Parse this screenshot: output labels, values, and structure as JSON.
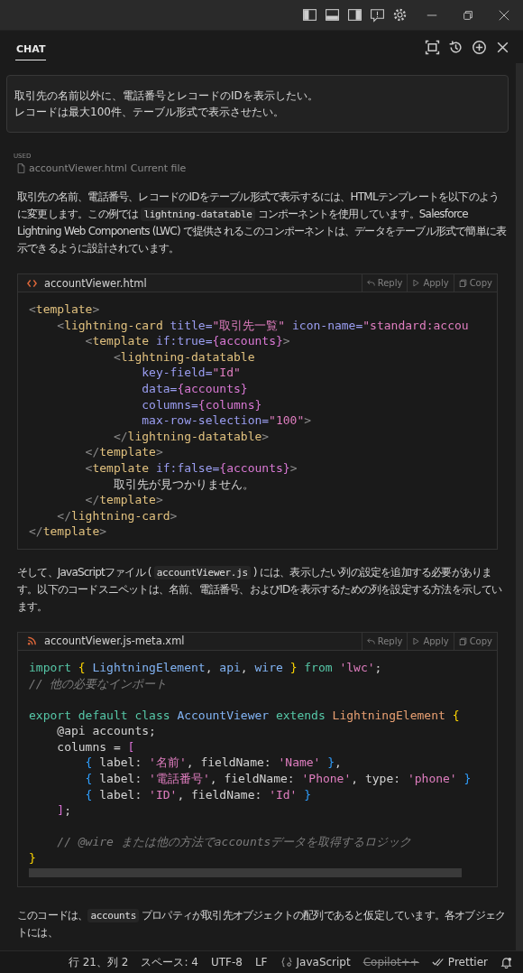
{
  "chat_tab": {
    "label": "CHAT",
    "selected": true
  },
  "user_message": [
    "取引先の名前以外に、電話番号とレコードのIDを表示したい。",
    "レコードは最大100件、テーブル形式で表示させたい。"
  ],
  "used": {
    "label": "USED",
    "file": "accountViewer.html",
    "note": "Current file"
  },
  "blocks": [
    {
      "kind": "paragraph",
      "segments": [
        {
          "kind": "text",
          "text": "取引先の名前、電話番号、レコードのIDをテーブル形式で表示するには、HTMLテンプレートを以下のように変更します。この例では "
        },
        {
          "kind": "code",
          "text": "lightning-datatable"
        },
        {
          "kind": "text",
          "text": " コンポーネントを使用しています。Salesforce Lightning Web Components (LWC) で提供されるこのコンポーネントは、データをテーブル形式で簡単に表示できるように設計されています。"
        }
      ]
    },
    {
      "kind": "code",
      "filename": "accountViewer.html",
      "actions": [
        "Reply",
        "Apply",
        "Copy"
      ],
      "scrollbar": false,
      "lines": [
        {
          "gap": false,
          "tokens": [
            {
              "kind": "punct",
              "text": "<"
            },
            {
              "kind": "tag",
              "text": "template"
            },
            {
              "kind": "punct",
              "text": ">"
            }
          ]
        },
        {
          "gap": false,
          "tokens": [
            {
              "kind": "punct",
              "text": "    <"
            },
            {
              "kind": "tag",
              "text": "lightning-card"
            },
            {
              "kind": "attr",
              "text": " title="
            },
            {
              "kind": "str",
              "text": "\"取引先一覧\""
            },
            {
              "kind": "attr",
              "text": " icon-name="
            },
            {
              "kind": "str",
              "text": "\"standard:accou"
            }
          ]
        },
        {
          "gap": false,
          "tokens": [
            {
              "kind": "punct",
              "text": "        <"
            },
            {
              "kind": "tag",
              "text": "template"
            },
            {
              "kind": "attr",
              "text": " if:true="
            },
            {
              "kind": "brace",
              "text": "{accounts}"
            },
            {
              "kind": "punct",
              "text": ">"
            }
          ]
        },
        {
          "gap": false,
          "tokens": [
            {
              "kind": "punct",
              "text": "            <"
            },
            {
              "kind": "tag",
              "text": "lightning-datatable"
            }
          ]
        },
        {
          "gap": false,
          "tokens": [
            {
              "kind": "attr",
              "text": "                key-field="
            },
            {
              "kind": "str",
              "text": "\"Id\""
            }
          ]
        },
        {
          "gap": false,
          "tokens": [
            {
              "kind": "attr",
              "text": "                data="
            },
            {
              "kind": "brace",
              "text": "{accounts}"
            }
          ]
        },
        {
          "gap": false,
          "tokens": [
            {
              "kind": "attr",
              "text": "                columns="
            },
            {
              "kind": "brace",
              "text": "{columns}"
            }
          ]
        },
        {
          "gap": false,
          "tokens": [
            {
              "kind": "attr",
              "text": "                max-row-selection="
            },
            {
              "kind": "str",
              "text": "\"100\""
            },
            {
              "kind": "punct",
              "text": ">"
            }
          ]
        },
        {
          "gap": false,
          "tokens": [
            {
              "kind": "punct",
              "text": "            </"
            },
            {
              "kind": "tag",
              "text": "lightning-datatable"
            },
            {
              "kind": "punct",
              "text": ">"
            }
          ]
        },
        {
          "gap": false,
          "tokens": [
            {
              "kind": "punct",
              "text": "        </"
            },
            {
              "kind": "tag",
              "text": "template"
            },
            {
              "kind": "punct",
              "text": ">"
            }
          ]
        },
        {
          "gap": false,
          "tokens": [
            {
              "kind": "punct",
              "text": "        <"
            },
            {
              "kind": "tag",
              "text": "template"
            },
            {
              "kind": "attr",
              "text": " if:false="
            },
            {
              "kind": "brace",
              "text": "{accounts}"
            },
            {
              "kind": "punct",
              "text": ">"
            }
          ]
        },
        {
          "gap": false,
          "tokens": [
            {
              "kind": "text",
              "text": "            取引先が見つかりません。"
            }
          ]
        },
        {
          "gap": false,
          "tokens": [
            {
              "kind": "punct",
              "text": "        </"
            },
            {
              "kind": "tag",
              "text": "template"
            },
            {
              "kind": "punct",
              "text": ">"
            }
          ]
        },
        {
          "gap": false,
          "tokens": [
            {
              "kind": "punct",
              "text": "    </"
            },
            {
              "kind": "tag",
              "text": "lightning-card"
            },
            {
              "kind": "punct",
              "text": ">"
            }
          ]
        },
        {
          "gap": false,
          "tokens": [
            {
              "kind": "punct",
              "text": "</"
            },
            {
              "kind": "tag",
              "text": "template"
            },
            {
              "kind": "punct",
              "text": ">"
            }
          ]
        }
      ]
    },
    {
      "kind": "paragraph",
      "segments": [
        {
          "kind": "text",
          "text": "そして、JavaScriptファイル ( "
        },
        {
          "kind": "code",
          "text": "accountViewer.js"
        },
        {
          "kind": "text",
          "text": " ) には、表示したい列の設定を追加する必要があります。以下のコードスニペットは、名前、電話番号、およびIDを表示するための列を設定する方法を示しています。"
        }
      ]
    },
    {
      "kind": "code",
      "filename": "accountViewer.js-meta.xml",
      "actions": [
        "Reply",
        "Apply",
        "Copy"
      ],
      "scrollbar": true,
      "lines": [
        {
          "gap": false,
          "tokens": [
            {
              "kind": "kw",
              "text": "import "
            },
            {
              "kind": "b1",
              "text": "{ "
            },
            {
              "kind": "var",
              "text": "LightningElement"
            },
            {
              "kind": "text",
              "text": ", "
            },
            {
              "kind": "var",
              "text": "api"
            },
            {
              "kind": "text",
              "text": ", "
            },
            {
              "kind": "var",
              "text": "wire "
            },
            {
              "kind": "b1",
              "text": "} "
            },
            {
              "kind": "kw",
              "text": "from "
            },
            {
              "kind": "str",
              "text": "'lwc'"
            },
            {
              "kind": "text",
              "text": ";"
            }
          ]
        },
        {
          "gap": false,
          "tokens": [
            {
              "kind": "comment",
              "text": "// 他の必要なインポート"
            }
          ]
        },
        {
          "gap": true,
          "tokens": [
            {
              "kind": "kw",
              "text": "export default class "
            },
            {
              "kind": "var",
              "text": "AccountViewer "
            },
            {
              "kind": "kw",
              "text": "extends "
            },
            {
              "kind": "cls",
              "text": "LightningElement "
            },
            {
              "kind": "b1",
              "text": "{"
            }
          ]
        },
        {
          "gap": false,
          "tokens": [
            {
              "kind": "text",
              "text": "    @api accounts;"
            }
          ]
        },
        {
          "gap": false,
          "tokens": [
            {
              "kind": "text",
              "text": "    columns = "
            },
            {
              "kind": "b2",
              "text": "["
            }
          ]
        },
        {
          "gap": false,
          "tokens": [
            {
              "kind": "b3",
              "text": "        {"
            },
            {
              "kind": "text",
              "text": " label: "
            },
            {
              "kind": "str",
              "text": "'名前'"
            },
            {
              "kind": "text",
              "text": ", fieldName: "
            },
            {
              "kind": "str",
              "text": "'Name'"
            },
            {
              "kind": "b3",
              "text": " }"
            },
            {
              "kind": "text",
              "text": ","
            }
          ]
        },
        {
          "gap": false,
          "tokens": [
            {
              "kind": "b3",
              "text": "        {"
            },
            {
              "kind": "text",
              "text": " label: "
            },
            {
              "kind": "str",
              "text": "'電話番号'"
            },
            {
              "kind": "text",
              "text": ", fieldName: "
            },
            {
              "kind": "str",
              "text": "'Phone'"
            },
            {
              "kind": "text",
              "text": ", type: "
            },
            {
              "kind": "str",
              "text": "'phone'"
            },
            {
              "kind": "b3",
              "text": " }"
            }
          ]
        },
        {
          "gap": false,
          "tokens": [
            {
              "kind": "b3",
              "text": "        {"
            },
            {
              "kind": "text",
              "text": " label: "
            },
            {
              "kind": "str",
              "text": "'ID'"
            },
            {
              "kind": "text",
              "text": ", fieldName: "
            },
            {
              "kind": "str",
              "text": "'Id'"
            },
            {
              "kind": "b3",
              "text": " }"
            }
          ]
        },
        {
          "gap": false,
          "tokens": [
            {
              "kind": "b2",
              "text": "    ]"
            },
            {
              "kind": "text",
              "text": ";"
            }
          ]
        },
        {
          "gap": true,
          "tokens": [
            {
              "kind": "comment",
              "text": "    // @wire または他の方法でaccountsデータを取得するロジック"
            }
          ]
        },
        {
          "gap": false,
          "tokens": [
            {
              "kind": "b1",
              "text": "}"
            }
          ]
        }
      ]
    },
    {
      "kind": "paragraph",
      "segments": [
        {
          "kind": "text",
          "text": "このコードは、"
        },
        {
          "kind": "code",
          "text": "accounts"
        },
        {
          "kind": "text",
          "text": " プロパティが取引先オブジェクトの配列であると仮定しています。各オブジェクトには、"
        }
      ]
    }
  ],
  "status_bar": [
    {
      "kind": "text",
      "text": "行 21、列 2"
    },
    {
      "kind": "text",
      "text": "スペース: 4"
    },
    {
      "kind": "text",
      "text": "UTF-8"
    },
    {
      "kind": "text",
      "text": "LF"
    },
    {
      "kind": "language",
      "text": "JavaScript"
    },
    {
      "kind": "struck",
      "text": "Copilot++"
    },
    {
      "kind": "formatter",
      "text": "Prettier"
    },
    {
      "kind": "bell"
    }
  ]
}
